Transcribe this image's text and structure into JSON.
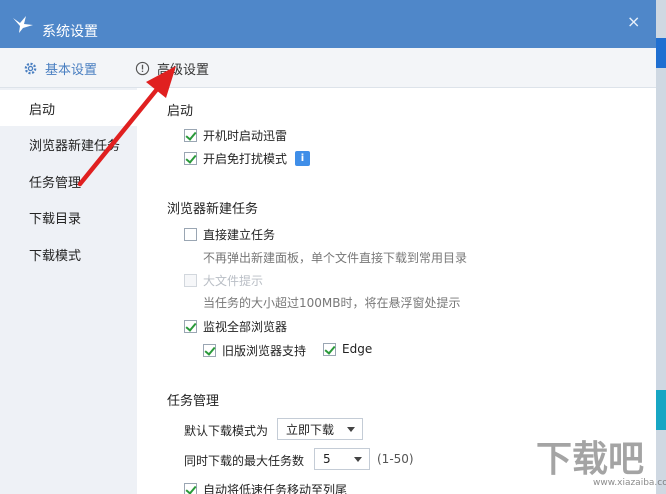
{
  "window": {
    "title": "系统设置",
    "close_glyph": "×"
  },
  "tabs": [
    {
      "label": "基本设置",
      "icon": "gear-icon"
    },
    {
      "label": "高级设置",
      "icon": "info-circle-icon"
    }
  ],
  "sidebar": {
    "items": [
      {
        "label": "启动",
        "active": true
      },
      {
        "label": "浏览器新建任务",
        "active": false
      },
      {
        "label": "任务管理",
        "active": false
      },
      {
        "label": "下载目录",
        "active": false
      },
      {
        "label": "下载模式",
        "active": false
      }
    ]
  },
  "sections": {
    "startup": {
      "title": "启动",
      "auto_start": {
        "label": "开机时启动迅雷",
        "checked": true
      },
      "dnd_mode": {
        "label": "开启免打扰模式",
        "checked": true,
        "info_glyph": "i"
      }
    },
    "browser": {
      "title": "浏览器新建任务",
      "direct_create": {
        "label": "直接建立任务",
        "checked": false
      },
      "direct_create_hint": "不再弹出新建面板，单个文件直接下载到常用目录",
      "big_file": {
        "label": "大文件提示",
        "checked": false,
        "disabled": true
      },
      "big_file_hint": "当任务的大小超过100MB时，将在悬浮窗处提示",
      "monitor_all": {
        "label": "监视全部浏览器",
        "checked": true
      },
      "legacy_support": {
        "label": "旧版浏览器支持",
        "checked": true
      },
      "edge": {
        "label": "Edge",
        "checked": true
      }
    },
    "tasks": {
      "title": "任务管理",
      "default_mode_label": "默认下载模式为",
      "default_mode_value": "立即下载",
      "max_tasks_label": "同时下载的最大任务数",
      "max_tasks_value": "5",
      "max_tasks_range": "(1-50)",
      "auto_move": {
        "label": "自动将低速任务移动至列尾",
        "checked": true
      }
    }
  },
  "watermark": {
    "text": "下载吧",
    "sub": "www.xiazaiba.com"
  },
  "colors": {
    "titlebar": "#4f87c9",
    "accent": "#4a7fc1",
    "arrow": "#e02020",
    "check": "#2a9a3a"
  }
}
